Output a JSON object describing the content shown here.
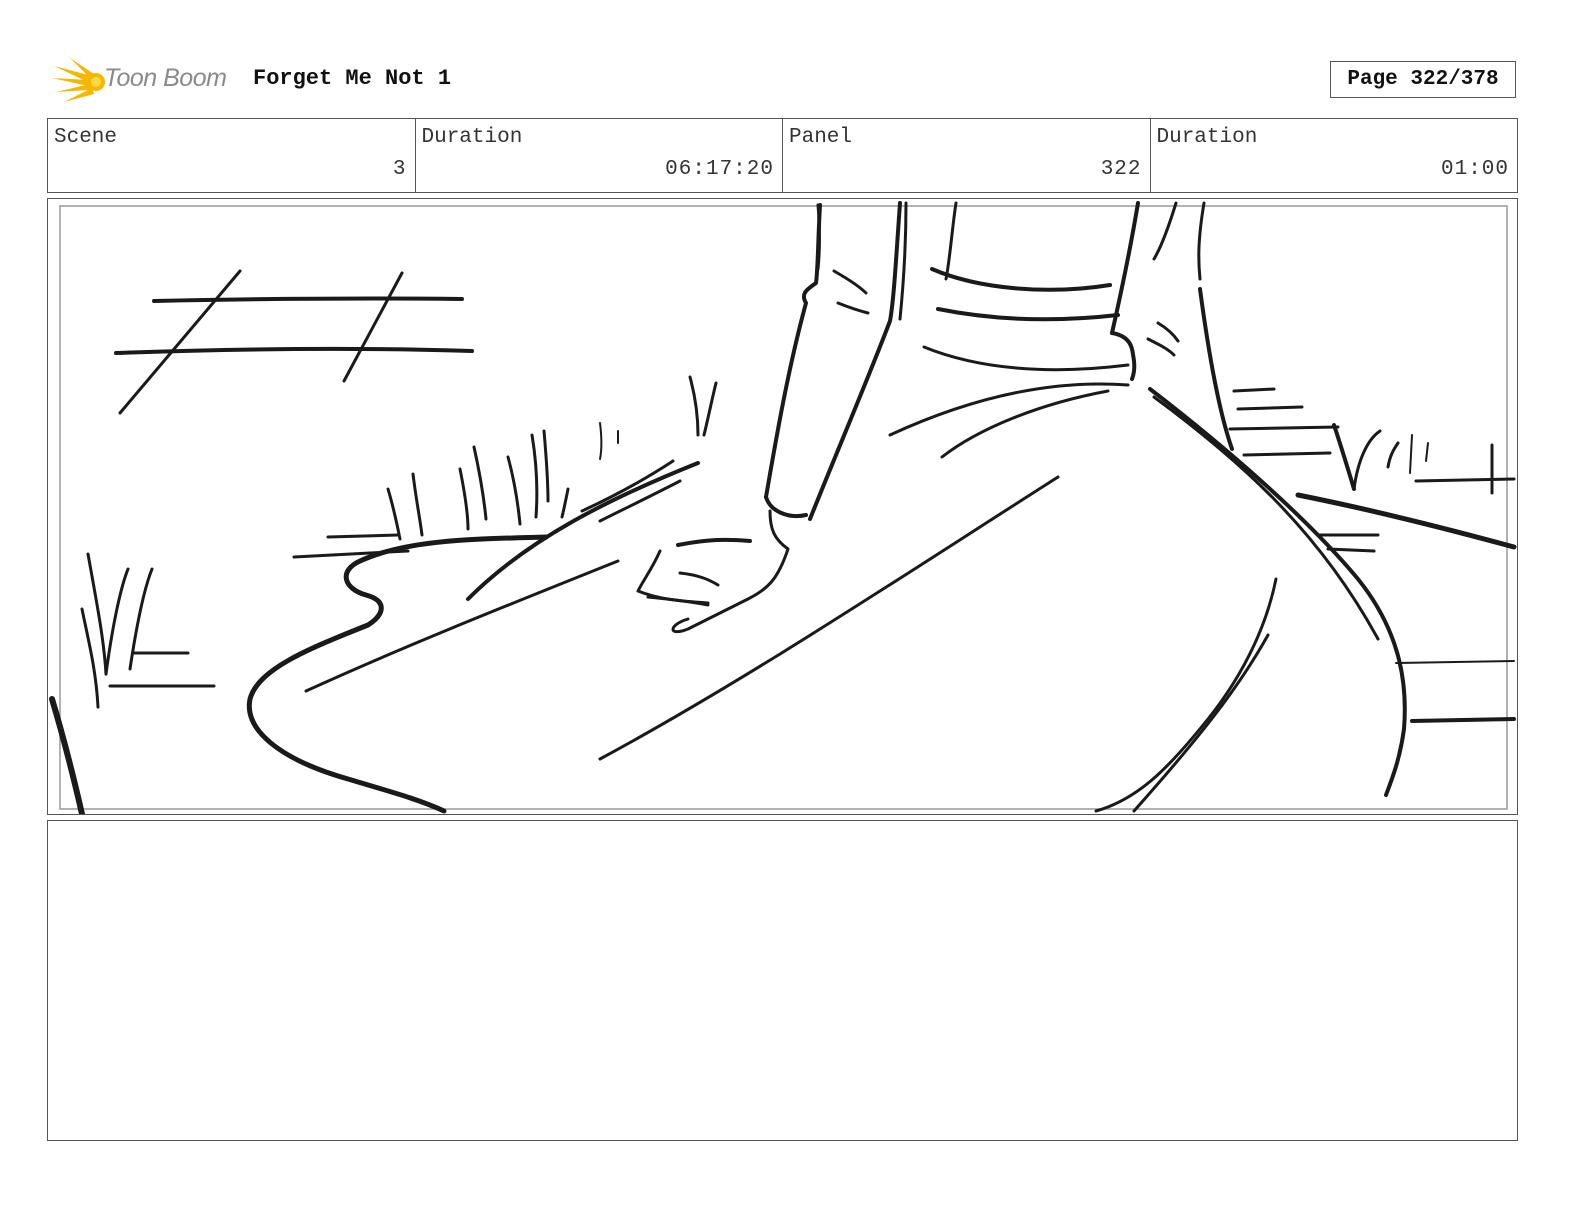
{
  "header": {
    "logo_text": "Toon Boom",
    "project_title": "Forget Me Not 1",
    "page_label": "Page 322/378"
  },
  "info": {
    "scene_label": "Scene",
    "scene_value": "3",
    "scene_duration_label": "Duration",
    "scene_duration_value": "06:17:20",
    "panel_label": "Panel",
    "panel_value": "322",
    "panel_duration_label": "Duration",
    "panel_duration_value": "01:00"
  },
  "notes": {
    "text": ""
  },
  "colors": {
    "logo_star": "#f5b700",
    "logo_text": "#8a8a8a",
    "border": "#555555",
    "sketch_ink": "#1a1a1a"
  }
}
